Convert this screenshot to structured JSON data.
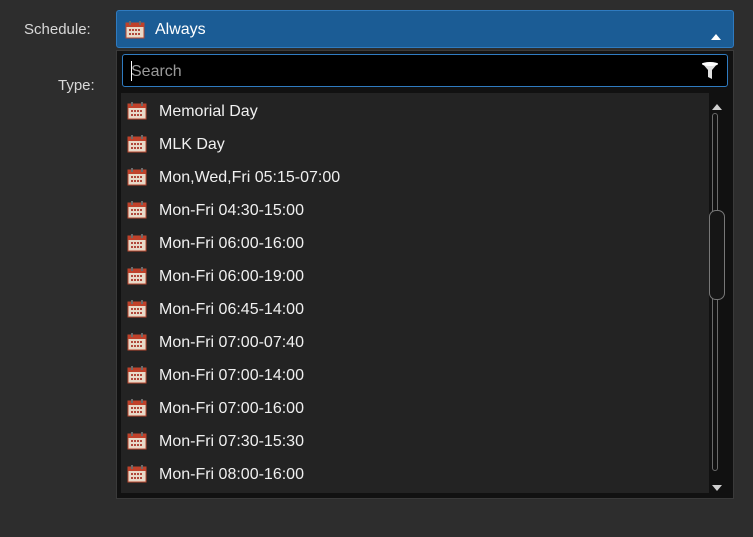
{
  "form": {
    "schedule_label": "Schedule:",
    "type_label": "Type:"
  },
  "combo": {
    "selected": "Always",
    "icon": "calendar-icon",
    "expanded": true
  },
  "search": {
    "placeholder": "Search",
    "value": ""
  },
  "options": [
    "Memorial Day",
    "MLK Day",
    "Mon,Wed,Fri 05:15-07:00",
    "Mon-Fri 04:30-15:00",
    "Mon-Fri 06:00-16:00",
    "Mon-Fri 06:00-19:00",
    "Mon-Fri 06:45-14:00",
    "Mon-Fri 07:00-07:40",
    "Mon-Fri 07:00-14:00",
    "Mon-Fri 07:00-16:00",
    "Mon-Fri 07:30-15:30",
    "Mon-Fri 08:00-16:00"
  ],
  "colors": {
    "accent": "#1b5c95",
    "accent_border": "#2f7bc0",
    "background": "#2d2d2d",
    "list_bg": "#232323"
  }
}
